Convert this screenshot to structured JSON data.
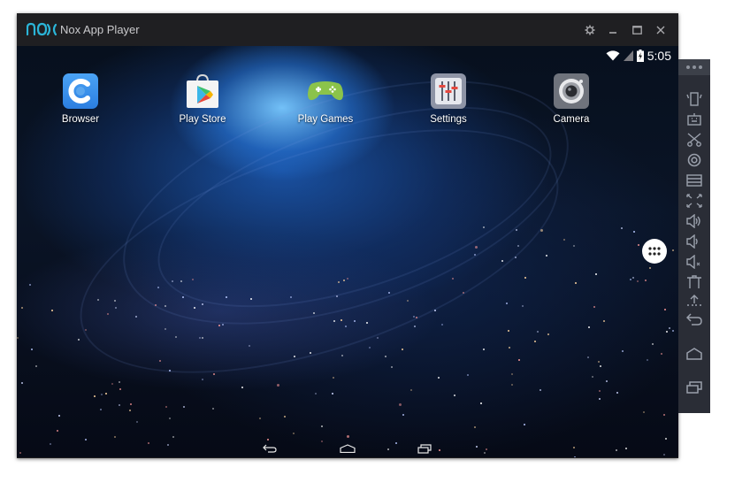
{
  "window": {
    "title": "Nox App Player",
    "logo_text": "nox",
    "brand_color": "#2bb5d8",
    "controls": [
      {
        "name": "settings",
        "icon": "gear-icon"
      },
      {
        "name": "minimize",
        "icon": "minimize-icon"
      },
      {
        "name": "maximize",
        "icon": "maximize-icon"
      },
      {
        "name": "close",
        "icon": "close-icon"
      }
    ]
  },
  "statusbar": {
    "time": "5:05",
    "icons": [
      "wifi-icon",
      "cell-signal-icon",
      "battery-charging-icon"
    ]
  },
  "apps": [
    {
      "label": "Browser",
      "icon": "browser-icon"
    },
    {
      "label": "Play Store",
      "icon": "play-store-icon"
    },
    {
      "label": "Play Games",
      "icon": "play-games-icon"
    },
    {
      "label": "Settings",
      "icon": "settings-app-icon"
    },
    {
      "label": "Camera",
      "icon": "camera-icon"
    }
  ],
  "app_drawer_button": {
    "icon": "app-drawer-icon"
  },
  "navbar": {
    "buttons": [
      {
        "name": "back",
        "icon": "back-icon"
      },
      {
        "name": "home",
        "icon": "home-icon"
      },
      {
        "name": "recents",
        "icon": "recents-icon"
      }
    ]
  },
  "sidebar": {
    "more_icon": "more-icon",
    "tools": [
      {
        "name": "rotate",
        "icon": "rotate-screen-icon"
      },
      {
        "name": "robot",
        "icon": "robot-icon"
      },
      {
        "name": "screenshot",
        "icon": "scissors-icon"
      },
      {
        "name": "location",
        "icon": "target-icon"
      },
      {
        "name": "keyboard",
        "icon": "keyboard-icon"
      },
      {
        "name": "fullscreen",
        "icon": "fullscreen-icon"
      },
      {
        "name": "volume-up",
        "icon": "volume-up-icon"
      },
      {
        "name": "volume-down",
        "icon": "volume-down-icon"
      },
      {
        "name": "mute",
        "icon": "mute-icon"
      },
      {
        "name": "uninstall",
        "icon": "trash-icon"
      },
      {
        "name": "install-apk",
        "icon": "upload-icon"
      },
      {
        "name": "back",
        "icon": "back-icon"
      },
      {
        "name": "home",
        "icon": "home-icon"
      },
      {
        "name": "recents",
        "icon": "recents-icon"
      }
    ]
  }
}
